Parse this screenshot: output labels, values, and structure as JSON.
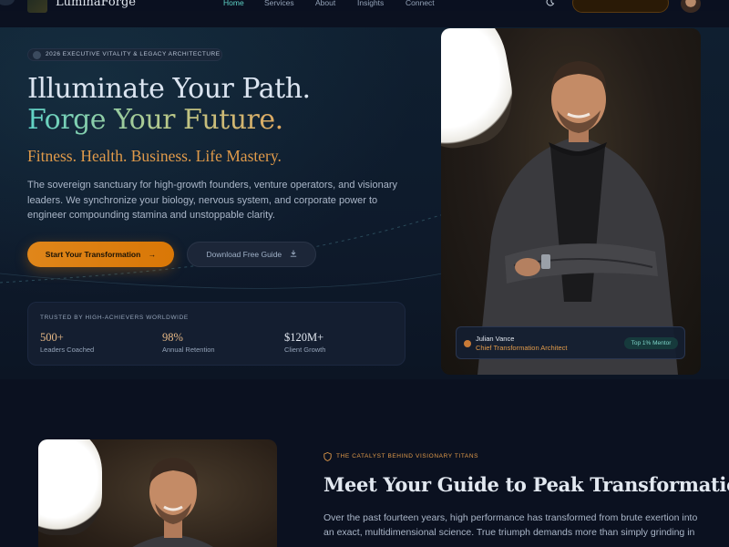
{
  "nav": {
    "brand": "LuminaForge",
    "links": [
      "Home",
      "Services",
      "About",
      "Insights",
      "Connect"
    ],
    "active_link": "Home",
    "theme_icon": "moon-icon",
    "accent_color": "#5fd3c7"
  },
  "hero": {
    "eyebrow": "2026 EXECUTIVE VITALITY & LEGACY ARCHITECTURE",
    "headline_line1": "Illuminate Your Path.",
    "headline_line2": "Forge Your Future.",
    "tagline": "Fitness. Health. Business. Life Mastery.",
    "lead": "The sovereign sanctuary for high-growth founders, venture operators, and visionary leaders. We synchronize your biology, nervous system, and corporate power to engineer compounding stamina and unstoppable clarity.",
    "primary_cta": "Start Your Transformation",
    "primary_cta_icon": "arrow-right-icon",
    "secondary_cta": "Download Free Guide",
    "secondary_cta_icon": "download-icon",
    "cta_color": "#d97706"
  },
  "trust": {
    "title": "TRUSTED BY HIGH-ACHIEVERS WORLDWIDE",
    "stats": [
      {
        "value": "500+",
        "label": "Leaders Coached"
      },
      {
        "value": "98%",
        "label": "Annual Retention"
      },
      {
        "value": "$120M+",
        "label": "Client Growth"
      }
    ]
  },
  "mentor_card": {
    "name": "Julian Vance",
    "role": "Chief Transformation Architect",
    "badge": "Top 1% Mentor"
  },
  "about": {
    "eyebrow": "THE CATALYST BEHIND VISIONARY TITANS",
    "eyebrow_icon": "shield-icon",
    "heading": "Meet Your Guide to Peak Transformation",
    "body": "Over the past fourteen years, high performance has transformed from brute exertion into an exact, multidimensional science. True triumph demands more than simply grinding in"
  }
}
